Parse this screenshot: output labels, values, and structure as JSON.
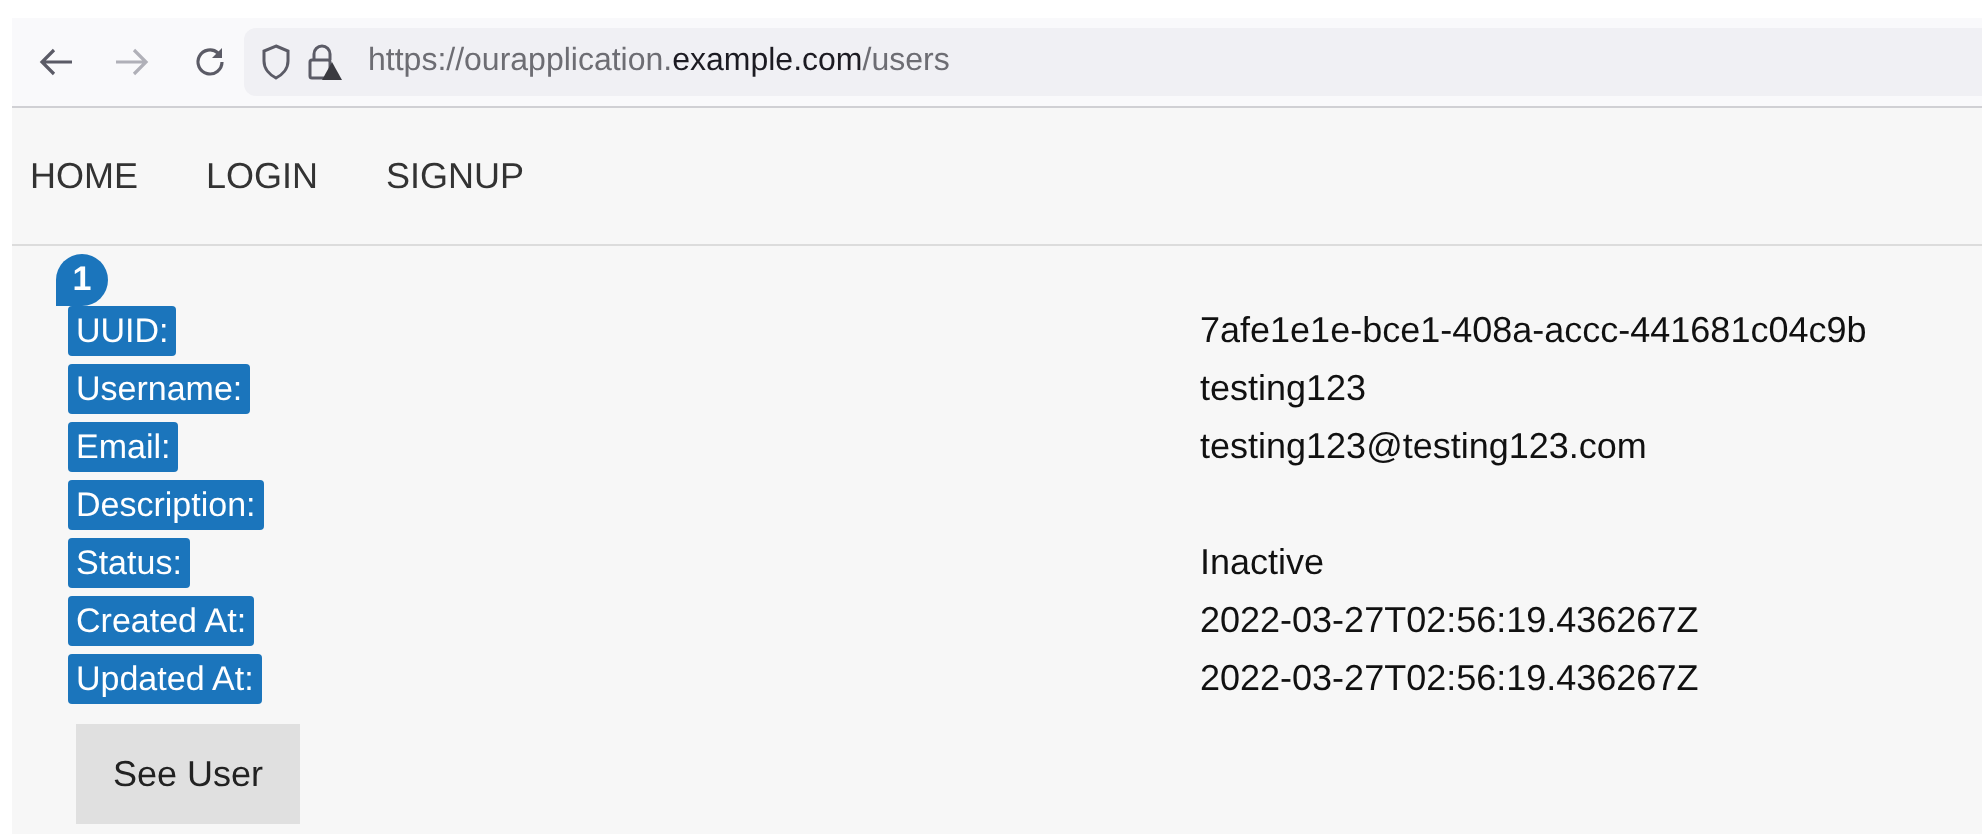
{
  "browser": {
    "url": {
      "prefix": "https://ourapplication.",
      "domain": "example.com",
      "path": "/users"
    }
  },
  "nav": [
    "HOME",
    "LOGIN",
    "SIGNUP"
  ],
  "user_card": {
    "badge": "1",
    "fields": [
      {
        "label": "UUID:",
        "value": "7afe1e1e-bce1-408a-accc-441681c04c9b"
      },
      {
        "label": "Username:",
        "value": "testing123"
      },
      {
        "label": "Email:",
        "value": "testing123@testing123.com"
      },
      {
        "label": "Description:"
      },
      {
        "label": "Status:",
        "value": "Inactive"
      },
      {
        "label": "Created At:",
        "value": "2022-03-27T02:56:19.436267Z"
      },
      {
        "label": "Updated At:",
        "value": "2022-03-27T02:56:19.436267Z"
      }
    ],
    "button": "See User"
  }
}
